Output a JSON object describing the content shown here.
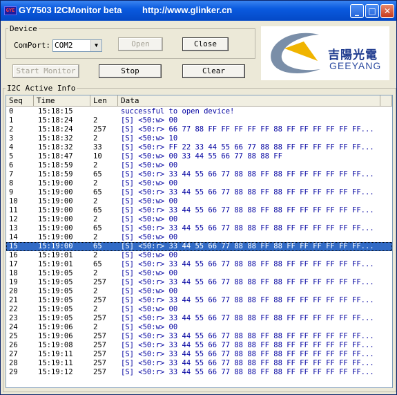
{
  "window": {
    "title": "GY7503 I2CMonitor beta",
    "url": "http://www.glinker.cn",
    "icon_text": "GYE"
  },
  "device": {
    "legend": "Device",
    "comport_label": "ComPort:",
    "comport_value": "COM2",
    "open_label": "Open",
    "close_label": "Close",
    "start_label": "Start Monitor",
    "stop_label": "Stop",
    "clear_label": "Clear"
  },
  "logo": {
    "cn": "吉陽光電",
    "en": "GEEYANG"
  },
  "info": {
    "legend": "I2C Active Info",
    "columns": [
      "Seq",
      "Time",
      "Len",
      "Data"
    ],
    "selected_seq": "15",
    "rows": [
      {
        "seq": "0",
        "time": "15:18:15",
        "len": "",
        "data": "successful to open device!"
      },
      {
        "seq": "1",
        "time": "15:18:24",
        "len": "2",
        "data": "[S] <50:w> 00"
      },
      {
        "seq": "2",
        "time": "15:18:24",
        "len": "257",
        "data": "[S] <50:r> 66 77 88 FF FF FF FF FF 88 FF FF FF FF FF FF..."
      },
      {
        "seq": "3",
        "time": "15:18:32",
        "len": "2",
        "data": "[S] <50:w> 10"
      },
      {
        "seq": "4",
        "time": "15:18:32",
        "len": "33",
        "data": "[S] <50:r> FF 22 33 44 55 66 77 88 88 FF FF FF FF FF FF..."
      },
      {
        "seq": "5",
        "time": "15:18:47",
        "len": "10",
        "data": "[S] <50:w> 00 33 44 55 66 77 88 88 FF"
      },
      {
        "seq": "6",
        "time": "15:18:59",
        "len": "2",
        "data": "[S] <50:w> 00"
      },
      {
        "seq": "7",
        "time": "15:18:59",
        "len": "65",
        "data": "[S] <50:r> 33 44 55 66 77 88 88 FF 88 FF FF FF FF FF FF..."
      },
      {
        "seq": "8",
        "time": "15:19:00",
        "len": "2",
        "data": "[S] <50:w> 00"
      },
      {
        "seq": "9",
        "time": "15:19:00",
        "len": "65",
        "data": "[S] <50:r> 33 44 55 66 77 88 88 FF 88 FF FF FF FF FF FF..."
      },
      {
        "seq": "10",
        "time": "15:19:00",
        "len": "2",
        "data": "[S] <50:w> 00"
      },
      {
        "seq": "11",
        "time": "15:19:00",
        "len": "65",
        "data": "[S] <50:r> 33 44 55 66 77 88 88 FF 88 FF FF FF FF FF FF..."
      },
      {
        "seq": "12",
        "time": "15:19:00",
        "len": "2",
        "data": "[S] <50:w> 00"
      },
      {
        "seq": "13",
        "time": "15:19:00",
        "len": "65",
        "data": "[S] <50:r> 33 44 55 66 77 88 88 FF 88 FF FF FF FF FF FF..."
      },
      {
        "seq": "14",
        "time": "15:19:00",
        "len": "2",
        "data": "[S] <50:w> 00"
      },
      {
        "seq": "15",
        "time": "15:19:00",
        "len": "65",
        "data": "[S] <50:r> 33 44 55 66 77 88 88 FF 88 FF FF FF FF FF FF..."
      },
      {
        "seq": "16",
        "time": "15:19:01",
        "len": "2",
        "data": "[S] <50:w> 00"
      },
      {
        "seq": "17",
        "time": "15:19:01",
        "len": "65",
        "data": "[S] <50:r> 33 44 55 66 77 88 88 FF 88 FF FF FF FF FF FF..."
      },
      {
        "seq": "18",
        "time": "15:19:05",
        "len": "2",
        "data": "[S] <50:w> 00"
      },
      {
        "seq": "19",
        "time": "15:19:05",
        "len": "257",
        "data": "[S] <50:r> 33 44 55 66 77 88 88 FF 88 FF FF FF FF FF FF..."
      },
      {
        "seq": "20",
        "time": "15:19:05",
        "len": "2",
        "data": "[S] <50:w> 00"
      },
      {
        "seq": "21",
        "time": "15:19:05",
        "len": "257",
        "data": "[S] <50:r> 33 44 55 66 77 88 88 FF 88 FF FF FF FF FF FF..."
      },
      {
        "seq": "22",
        "time": "15:19:05",
        "len": "2",
        "data": "[S] <50:w> 00"
      },
      {
        "seq": "23",
        "time": "15:19:05",
        "len": "257",
        "data": "[S] <50:r> 33 44 55 66 77 88 88 FF 88 FF FF FF FF FF FF..."
      },
      {
        "seq": "24",
        "time": "15:19:06",
        "len": "2",
        "data": "[S] <50:w> 00"
      },
      {
        "seq": "25",
        "time": "15:19:06",
        "len": "257",
        "data": "[S] <50:r> 33 44 55 66 77 88 88 FF 88 FF FF FF FF FF FF..."
      },
      {
        "seq": "26",
        "time": "15:19:08",
        "len": "257",
        "data": "[S] <50:r> 33 44 55 66 77 88 88 FF 88 FF FF FF FF FF FF..."
      },
      {
        "seq": "27",
        "time": "15:19:11",
        "len": "257",
        "data": "[S] <50:r> 33 44 55 66 77 88 88 FF 88 FF FF FF FF FF FF..."
      },
      {
        "seq": "28",
        "time": "15:19:11",
        "len": "257",
        "data": "[S] <50:r> 33 44 55 66 77 88 88 FF 88 FF FF FF FF FF FF..."
      },
      {
        "seq": "29",
        "time": "15:19:12",
        "len": "257",
        "data": "[S] <50:r> 33 44 55 66 77 88 88 FF 88 FF FF FF FF FF FF..."
      }
    ]
  },
  "colors": {
    "titlebar": "#0a5adf",
    "selected_row": "#316ac5",
    "data_text": "#0000a0",
    "logo_arc": "#7a8ea8",
    "logo_triangle": "#f0b400"
  }
}
